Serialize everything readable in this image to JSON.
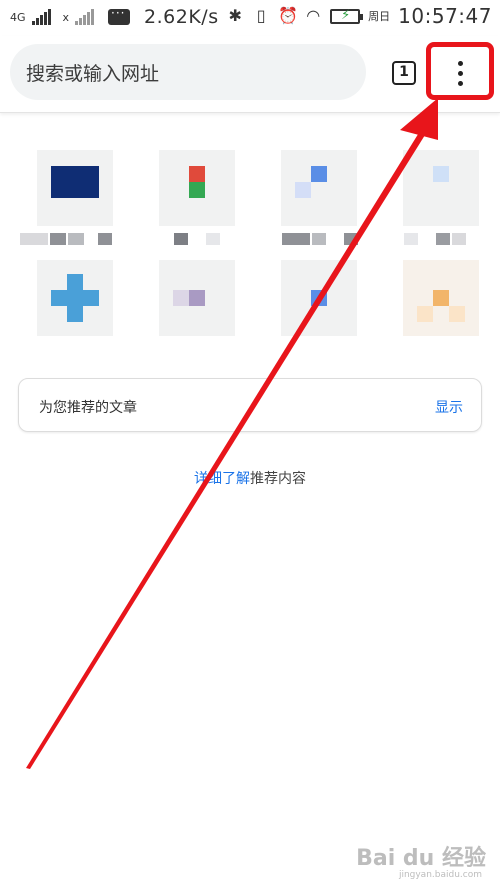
{
  "status_bar": {
    "network_1": "4G",
    "network_2": "x",
    "speed": "2.62K/s",
    "weekday": "周日",
    "time": "10:57:47",
    "icons": [
      "signal-icon",
      "message-icon",
      "bluetooth-icon",
      "vibrate-icon",
      "alarm-icon",
      "wifi-icon",
      "battery-charging-icon"
    ]
  },
  "toolbar": {
    "search_placeholder": "搜索或输入网址",
    "tab_count": "1",
    "menu_icon": "more-vert-icon"
  },
  "recommended": {
    "title": "为您推荐的文章",
    "action": "显示"
  },
  "learn_more": {
    "link": "详细了解",
    "text": "推荐内容"
  },
  "watermark": {
    "brand": "Bai du 经验",
    "url": "jingyan.baidu.com"
  },
  "colors": {
    "accent_link": "#1a73e8",
    "annotation_red": "#e8151b",
    "omnibox_bg": "#f1f3f4"
  }
}
